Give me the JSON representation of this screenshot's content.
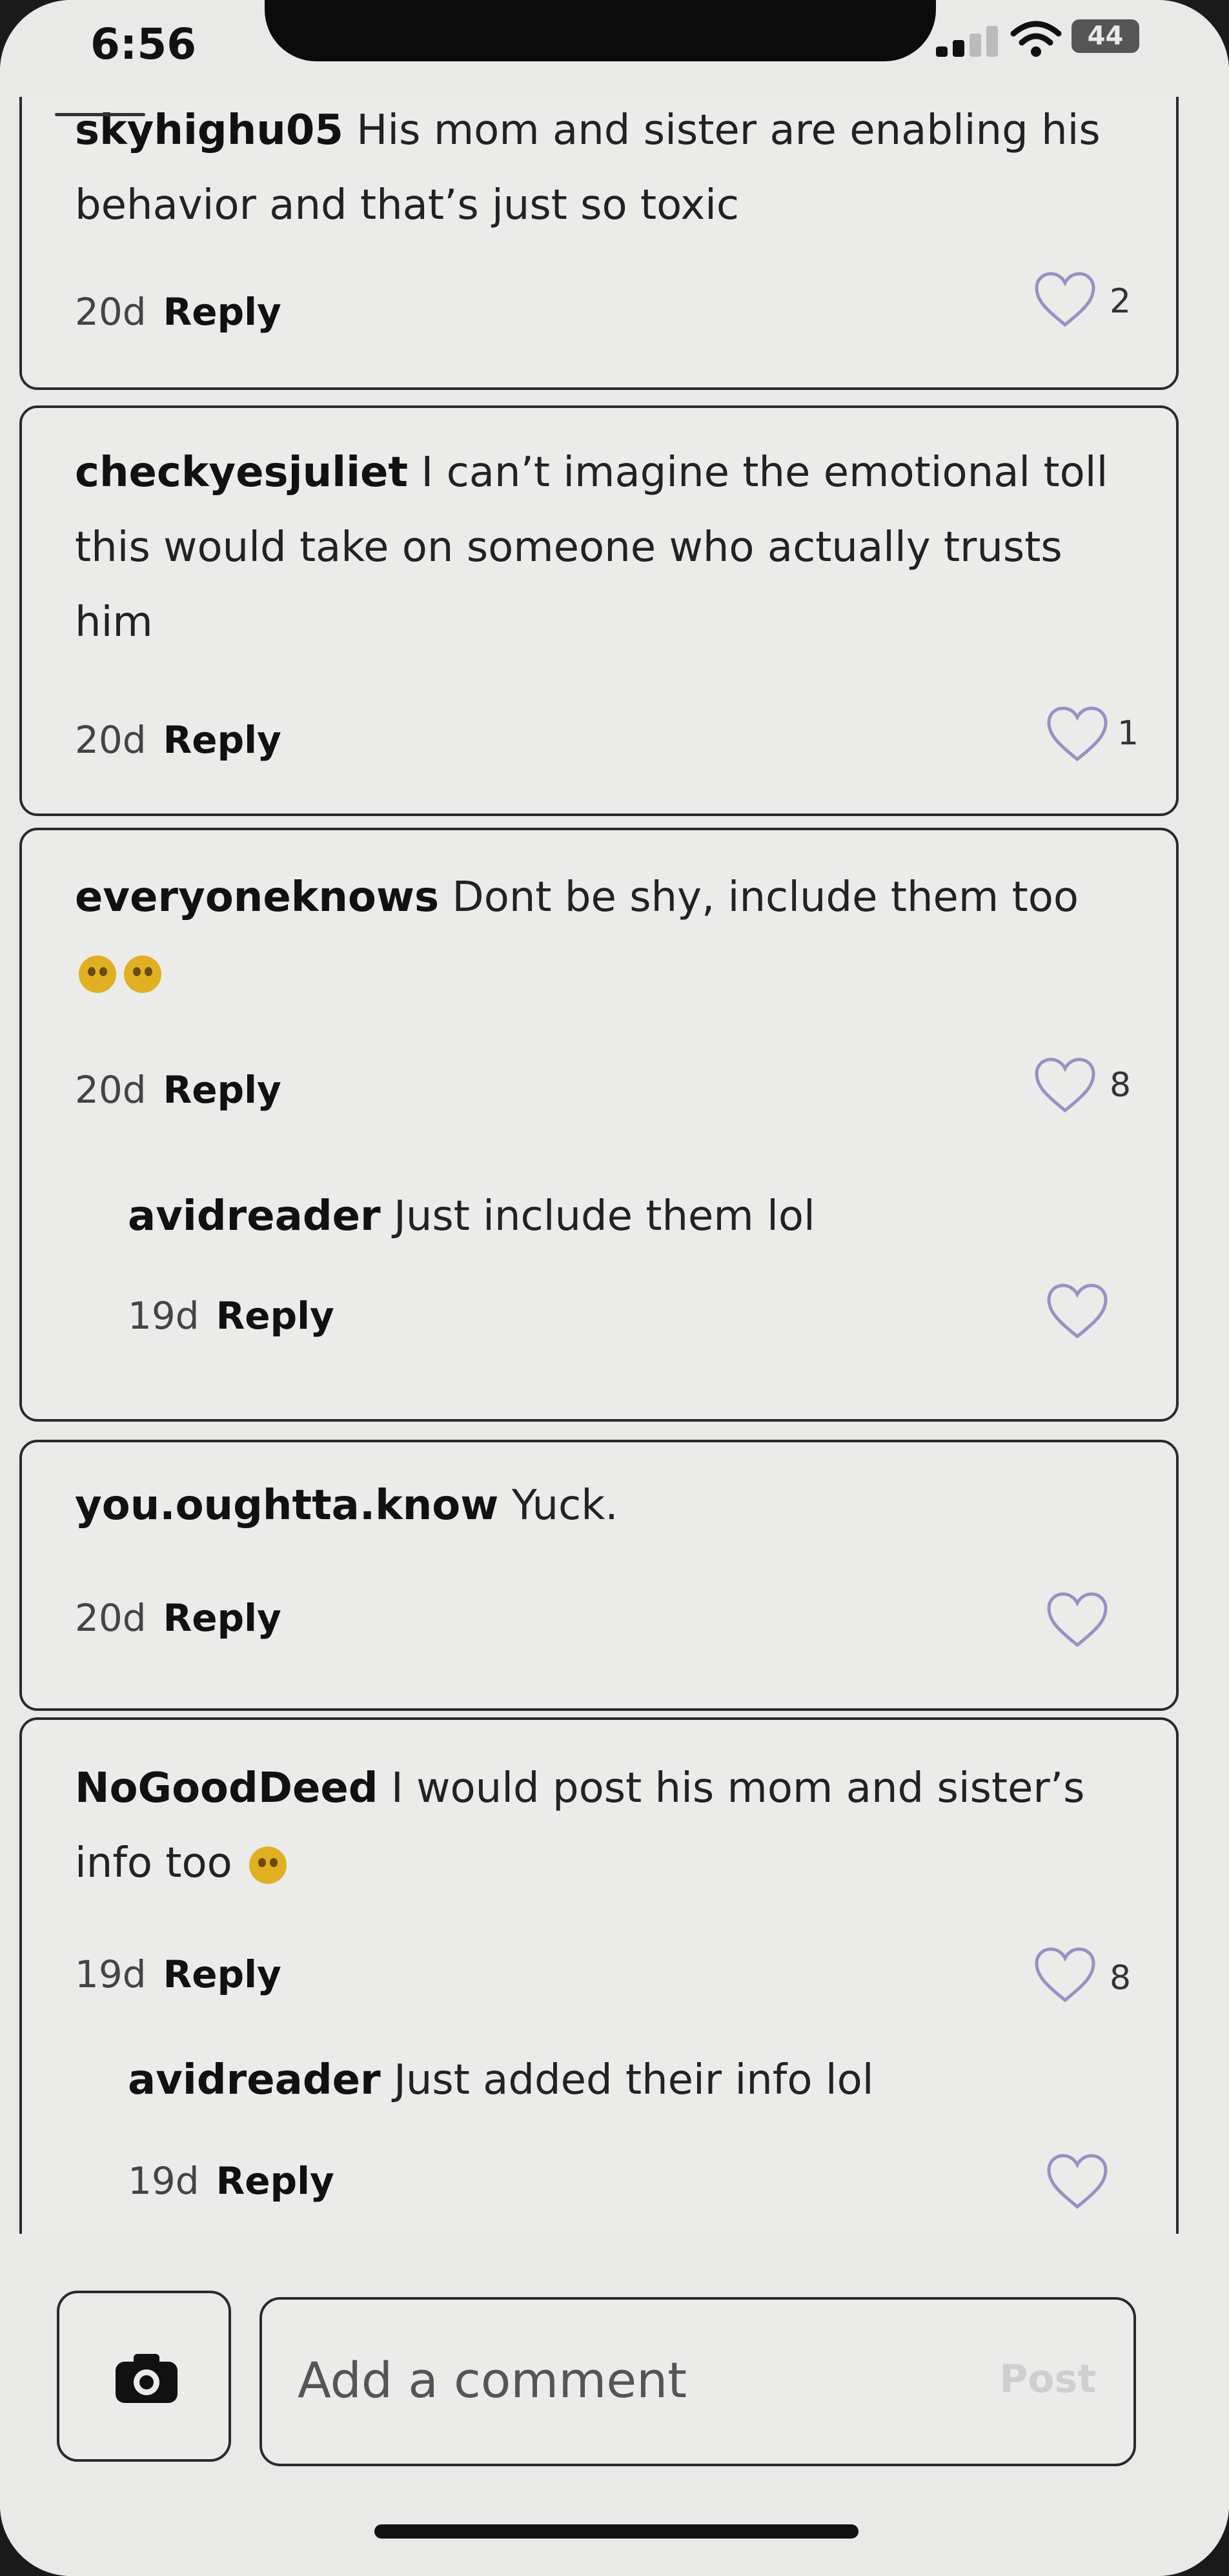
{
  "status_bar": {
    "time": "6:56",
    "battery": "44"
  },
  "comments": [
    {
      "username": "skyhighu05",
      "text": "His mom and sister are enabling his behavior and that’s just so toxic",
      "age": "20d",
      "reply_label": "Reply",
      "likes": "2",
      "replies": []
    },
    {
      "username": "checkyesjuliet",
      "text": "I can’t imagine the emotional toll this would take on someone who actually trusts him",
      "age": "20d",
      "reply_label": "Reply",
      "likes": "1",
      "replies": []
    },
    {
      "username": "everyoneknows",
      "text": "Dont be shy, include them too",
      "emoji": [
        "face-with-hand-over-mouth",
        "face-with-hand-over-mouth"
      ],
      "age": "20d",
      "reply_label": "Reply",
      "likes": "8",
      "replies": [
        {
          "username": "avidreader",
          "text": "Just include them lol",
          "age": "19d",
          "reply_label": "Reply",
          "likes": ""
        }
      ]
    },
    {
      "username": "you.oughtta.know",
      "text": "Yuck.",
      "age": "20d",
      "reply_label": "Reply",
      "likes": "",
      "replies": []
    },
    {
      "username": "NoGoodDeed",
      "text": "I would post his mom and sister’s info too",
      "emoji": [
        "rolling-on-floor-laughing"
      ],
      "age": "19d",
      "reply_label": "Reply",
      "likes": "8",
      "replies": [
        {
          "username": "avidreader",
          "text": "Just added their info lol",
          "age": "19d",
          "reply_label": "Reply",
          "likes": ""
        }
      ]
    }
  ],
  "composer": {
    "placeholder": "Add a comment",
    "post_label": "Post",
    "camera_icon": "camera-icon"
  },
  "colors": {
    "heart_outline": "#9b8fc4",
    "border": "#2a2a2a",
    "background": "#e9e9e7"
  }
}
